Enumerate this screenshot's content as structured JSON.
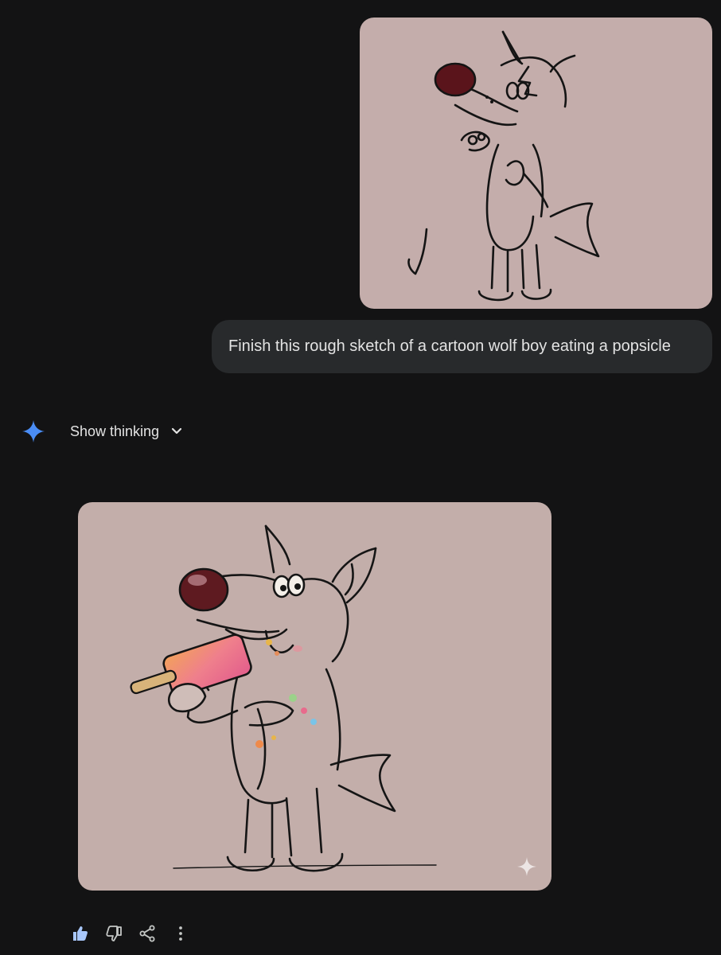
{
  "conversation": {
    "user_message": "Finish this rough sketch of a cartoon wolf boy eating a popsicle",
    "assistant": {
      "thinking_toggle_label": "Show thinking"
    }
  },
  "icons": {
    "assistant_logo": "gemini-spark-icon",
    "thinking_toggle": "chevron-down-icon",
    "watermark": "sparkle-watermark-icon",
    "actions": [
      "thumbs-up-icon",
      "thumbs-down-icon",
      "share-icon",
      "more-vert-icon"
    ]
  },
  "colors": {
    "background": "#131314",
    "bubble": "#282a2c",
    "image_background": "#c4adab",
    "spark_blue": "#4a8df6"
  }
}
